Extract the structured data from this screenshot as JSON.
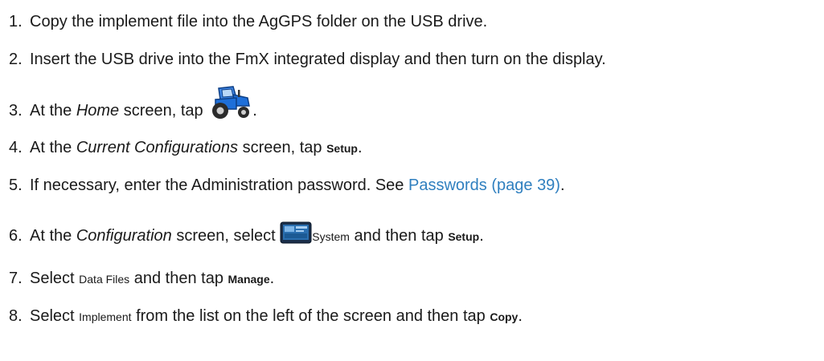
{
  "steps": [
    {
      "number": "1.",
      "text": "Copy the implement file into the AgGPS folder on the USB drive."
    },
    {
      "number": "2.",
      "text": "Insert the USB drive into the FmX integrated display and then turn on the display."
    },
    {
      "number": "3.",
      "pre": "At the ",
      "screen": "Home",
      "mid": " screen, tap ",
      "icon": "tractor-icon",
      "post": "."
    },
    {
      "number": "4.",
      "pre": "At the ",
      "screen": "Current Configurations",
      "mid": " screen, tap ",
      "button": "Setup",
      "post": "."
    },
    {
      "number": "5.",
      "pre": "If necessary, enter the Administration password. See ",
      "link": "Passwords (page 39)",
      "post": "."
    },
    {
      "number": "6.",
      "pre": "At the ",
      "screen": "Configuration",
      "mid": " screen, select ",
      "icon": "display-icon",
      "item": "System",
      "mid2": " and then tap ",
      "button": "Setup",
      "post": "."
    },
    {
      "number": "7.",
      "pre": "Select ",
      "item": "Data Files",
      "mid": " and then tap ",
      "button": "Manage",
      "post": "."
    },
    {
      "number": "8.",
      "pre": "Select ",
      "item": "Implement",
      "mid": " from the list on the left of the screen and then tap ",
      "button": "Copy",
      "post": "."
    }
  ],
  "colors": {
    "text": "#1a1a1a",
    "link": "#2f7fbf",
    "tractor_body": "#1e6fd9",
    "display_screen": "#2a6fb0"
  }
}
